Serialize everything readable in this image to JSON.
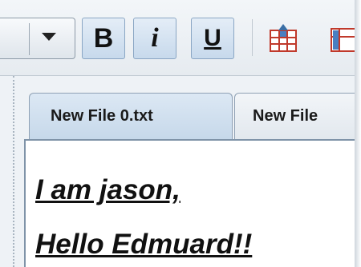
{
  "toolbar": {
    "bold_label": "B",
    "italic_label": "i",
    "underline_label": "U",
    "icons": [
      "dropdown-arrow-icon",
      "table-insert-row-icon",
      "table-insert-column-icon"
    ]
  },
  "tabs": [
    {
      "label": "New File 0.txt",
      "active": true
    },
    {
      "label": "New File",
      "active": false
    }
  ],
  "editor": {
    "lines": [
      "I am jason,",
      "Hello Edmuard!!"
    ]
  },
  "colors": {
    "accent": "#c7d9ec",
    "button_border": "#8aa6c4",
    "text": "#111111"
  }
}
